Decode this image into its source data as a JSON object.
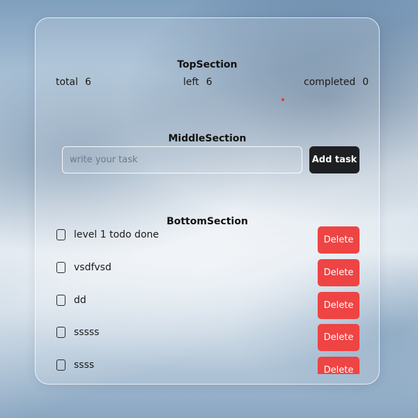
{
  "top_section": {
    "title": "TopSection",
    "total_label": "total",
    "total_value": "6",
    "left_label": "left",
    "left_value": "6",
    "completed_label": "completed",
    "completed_value": "0"
  },
  "middle_section": {
    "title": "MiddleSection",
    "input_value": "",
    "input_placeholder": "write your task",
    "add_button_label": "Add task"
  },
  "bottom_section": {
    "title": "BottomSection",
    "delete_label": "Delete",
    "tasks": [
      {
        "label": "level 1 todo done",
        "checked": false
      },
      {
        "label": "vsdfvsd",
        "checked": false
      },
      {
        "label": "dd",
        "checked": false
      },
      {
        "label": "sssss",
        "checked": false
      },
      {
        "label": "ssss",
        "checked": false
      }
    ]
  },
  "colors": {
    "add_button": "#1d1f22",
    "delete_button": "#ee4444",
    "indicator_dot": "#e03a3a"
  }
}
